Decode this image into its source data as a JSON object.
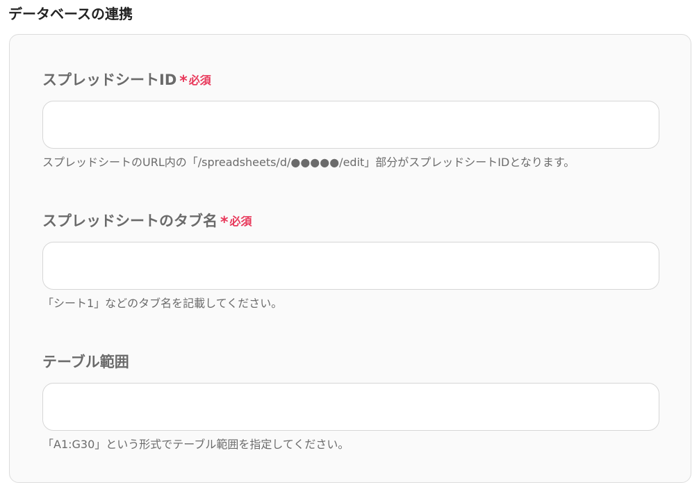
{
  "section": {
    "title": "データベースの連携"
  },
  "fields": [
    {
      "label": "スプレッドシートID",
      "asterisk": "*",
      "required_label": "必須",
      "value": "",
      "help": "スプレッドシートのURL内の「/spreadsheets/d/●●●●●/edit」部分がスプレッドシートIDとなります。"
    },
    {
      "label": "スプレッドシートのタブ名",
      "asterisk": "*",
      "required_label": "必須",
      "value": "",
      "help": "「シート1」などのタブ名を記載してください。"
    },
    {
      "label": "テーブル範囲",
      "value": "",
      "help": "「A1:G30」という形式でテーブル範囲を指定してください。"
    }
  ],
  "colors": {
    "required": "#e8385a",
    "label": "#6a6a6a",
    "panel_bg": "#fafafa",
    "panel_border": "#dcdcdc"
  }
}
